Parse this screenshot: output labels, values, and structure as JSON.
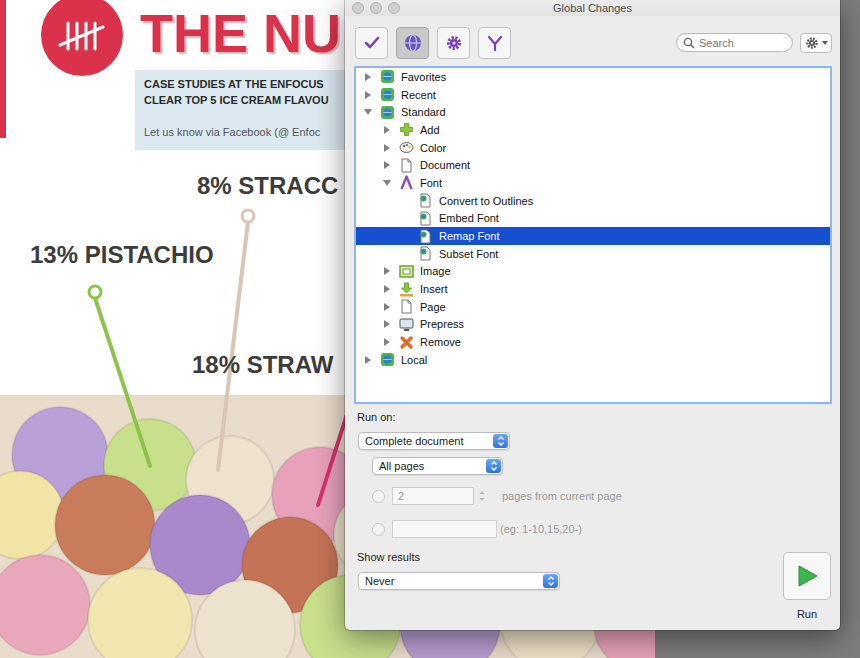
{
  "document": {
    "title": "THE NU",
    "intro": [
      "CASE STUDIES AT THE ENFOCUS",
      "CLEAR TOP 5 ICE CREAM FLAVOU"
    ],
    "cta": "Let us know via Facebook (@ Enfoc",
    "flavours": [
      {
        "text": "8% STRACC",
        "color": "#d9c6b5"
      },
      {
        "text": "13% PISTACHIO",
        "color": "#8cc34a"
      },
      {
        "text": "18% STRAW",
        "color": "#d6336c"
      }
    ]
  },
  "window": {
    "title": "Global Changes"
  },
  "toolbar": {
    "buttons": [
      {
        "selected": false
      },
      {
        "selected": true
      },
      {
        "selected": false
      },
      {
        "selected": false
      }
    ]
  },
  "search": {
    "placeholder": "Search"
  },
  "tree": [
    {
      "label": "Favorites",
      "kind": "group",
      "expanded": false,
      "selected": false,
      "children": []
    },
    {
      "label": "Recent",
      "kind": "group",
      "expanded": false,
      "selected": false,
      "children": []
    },
    {
      "label": "Standard",
      "kind": "group",
      "expanded": true,
      "selected": false,
      "children": [
        {
          "label": "Add",
          "kind": "group",
          "expanded": false,
          "selected": false,
          "children": []
        },
        {
          "label": "Color",
          "kind": "group",
          "expanded": false,
          "selected": false,
          "children": []
        },
        {
          "label": "Document",
          "kind": "group",
          "expanded": false,
          "selected": false,
          "children": []
        },
        {
          "label": "Font",
          "kind": "group",
          "expanded": true,
          "selected": false,
          "children": [
            {
              "label": "Convert to Outlines",
              "kind": "action",
              "expanded": false,
              "selected": false,
              "children": []
            },
            {
              "label": "Embed Font",
              "kind": "action",
              "expanded": false,
              "selected": false,
              "children": []
            },
            {
              "label": "Remap Font",
              "kind": "action",
              "expanded": false,
              "selected": true,
              "children": []
            },
            {
              "label": "Subset Font",
              "kind": "action",
              "expanded": false,
              "selected": false,
              "children": []
            }
          ]
        },
        {
          "label": "Image",
          "kind": "group",
          "expanded": false,
          "selected": false,
          "children": []
        },
        {
          "label": "Insert",
          "kind": "group",
          "expanded": false,
          "selected": false,
          "children": []
        },
        {
          "label": "Page",
          "kind": "group",
          "expanded": false,
          "selected": false,
          "children": []
        },
        {
          "label": "Prepress",
          "kind": "group",
          "expanded": false,
          "selected": false,
          "children": []
        },
        {
          "label": "Remove",
          "kind": "group",
          "expanded": false,
          "selected": false,
          "children": []
        }
      ]
    },
    {
      "label": "Local",
      "kind": "group",
      "expanded": false,
      "selected": false,
      "children": []
    }
  ],
  "run_on": {
    "label": "Run on:",
    "scope": "Complete document",
    "pages": "All pages",
    "options": [
      {
        "value": "2",
        "text": "pages from current page",
        "selected": false,
        "disabled": true
      },
      {
        "value": "",
        "text": "(eg: 1-10,15,20-)",
        "selected": false,
        "disabled": true
      }
    ]
  },
  "show_results": {
    "label": "Show results",
    "value": "Never"
  },
  "run": {
    "label": "Run"
  }
}
